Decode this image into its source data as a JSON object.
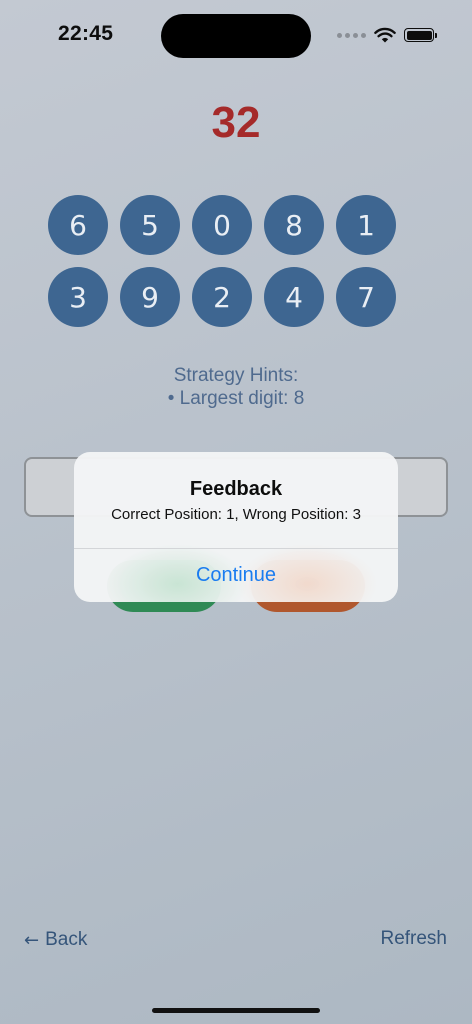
{
  "status_bar": {
    "time": "22:45",
    "icons": [
      "signal-dots-icon",
      "wifi-icon",
      "battery-icon"
    ]
  },
  "game": {
    "target": "32",
    "digits": [
      "6",
      "5",
      "0",
      "8",
      "1",
      "3",
      "9",
      "2",
      "4",
      "7"
    ],
    "hints": {
      "title": "Strategy Hints:",
      "items": [
        "• Largest digit: 8"
      ]
    }
  },
  "alert": {
    "title": "Feedback",
    "message": "Correct Position: 1, Wrong Position: 3",
    "action_label": "Continue"
  },
  "nav": {
    "back_label": "Back",
    "back_icon": "←",
    "refresh_label": "Refresh"
  },
  "colors": {
    "target": "#a52a2a",
    "digit_bg": "#3e6691",
    "hint_text": "#4f6a8e",
    "submit_bg": "#2f8a55",
    "clear_bg": "#b0572d",
    "link": "#1a7cf0"
  }
}
